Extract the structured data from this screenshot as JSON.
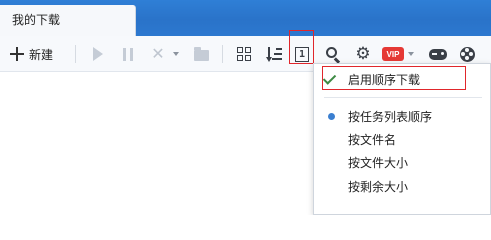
{
  "tab": {
    "label": "我的下载"
  },
  "toolbar": {
    "new_label": "新建",
    "vip_label": "VIP",
    "seq_glyph": "1",
    "gear_glyph": "⚙"
  },
  "menu": {
    "items": [
      {
        "label": "启用顺序下载",
        "checked": true
      },
      {
        "label": "按任务列表顺序",
        "selected": true
      },
      {
        "label": "按文件名"
      },
      {
        "label": "按文件大小"
      },
      {
        "label": "按剩余大小"
      }
    ]
  },
  "colors": {
    "title_bar": "#2a73c9",
    "highlight_border": "#e0262b",
    "check": "#3d8a44",
    "radio_dot": "#3b7fd0",
    "vip_badge": "#e53935"
  },
  "icons": [
    "plus-icon",
    "play-icon",
    "pause-icon",
    "delete-icon",
    "folder-icon",
    "grid-view-icon",
    "sort-icon",
    "sequential-download-icon",
    "search-icon",
    "gear-icon",
    "vip-icon",
    "game-icon",
    "film-icon",
    "check-icon",
    "radio-dot-icon"
  ]
}
